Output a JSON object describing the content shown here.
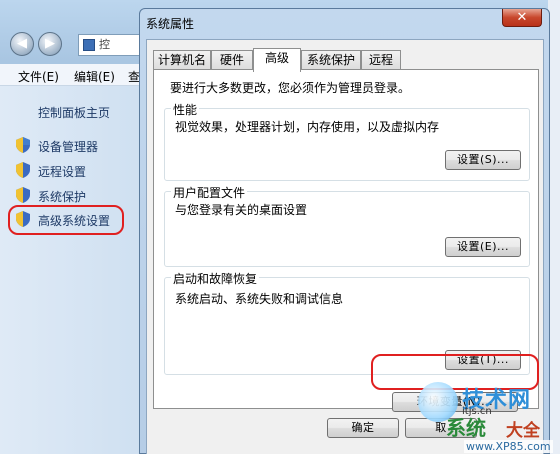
{
  "background_window": {
    "address_text": "控",
    "menu": [
      "文件(E)",
      "编辑(E)",
      "查"
    ],
    "sidebar_home": "控制面板主页",
    "sidebar_items": [
      "设备管理器",
      "远程设置",
      "系统保护",
      "高级系统设置"
    ]
  },
  "dialog": {
    "title": "系统属性",
    "close_glyph": "✕",
    "tabs": [
      "计算机名",
      "硬件",
      "高级",
      "系统保护",
      "远程"
    ],
    "active_tab": "高级",
    "admin_note": "要进行大多数更改，您必须作为管理员登录。",
    "groups": [
      {
        "title": "性能",
        "desc": "视觉效果，处理器计划，内存使用，以及虚拟内存",
        "button": "设置(S)..."
      },
      {
        "title": "用户配置文件",
        "desc": "与您登录有关的桌面设置",
        "button": "设置(E)..."
      },
      {
        "title": "启动和故障恢复",
        "desc": "系统启动、系统失败和调试信息",
        "button": "设置(T)..."
      }
    ],
    "env_button": "环境变量(N)...",
    "ok_button": "确定",
    "cancel_button": "取"
  },
  "watermark": {
    "line1": "技术网",
    "sub": "itjs.cn",
    "line2": "系统",
    "line3": "大全",
    "line4": "www.XP85.com"
  },
  "colors": {
    "highlight_circle": "#e02020",
    "dialog_frame": "#b6cde6"
  }
}
